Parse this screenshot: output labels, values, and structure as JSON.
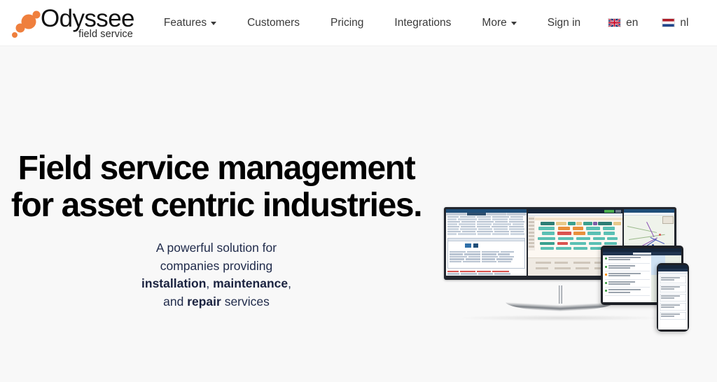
{
  "header": {
    "logo": {
      "name": "Odyssee",
      "tagline": "field service",
      "mark_icon": "odyssee-dots-logo",
      "accent_color": "#ef7f3d"
    },
    "nav_items": [
      {
        "label": "Features",
        "has_dropdown": true,
        "name": "nav-features"
      },
      {
        "label": "Customers",
        "has_dropdown": false,
        "name": "nav-customers"
      },
      {
        "label": "Pricing",
        "has_dropdown": false,
        "name": "nav-pricing"
      },
      {
        "label": "Integrations",
        "has_dropdown": false,
        "name": "nav-integrations"
      },
      {
        "label": "More",
        "has_dropdown": true,
        "name": "nav-more"
      }
    ],
    "sign_in_label": "Sign in",
    "languages": [
      {
        "code": "en",
        "flag": "uk-flag-icon"
      },
      {
        "code": "nl",
        "flag": "netherlands-flag-icon"
      }
    ]
  },
  "hero": {
    "title_line1": "Field service management",
    "title_line2": "for asset centric industries.",
    "sub_line1": "A powerful solution for",
    "sub_line2": "companies providing",
    "sub_strong1": "installation",
    "sub_comma1": ", ",
    "sub_strong2": "maintenance",
    "sub_comma2": ",",
    "sub_and": "and ",
    "sub_strong3": "repair",
    "sub_tail": " services",
    "title_color": "#000000",
    "sub_color": "#1f2a4a",
    "background_color": "#f8f8f8"
  },
  "mockup": {
    "alt": "Odyssee field service software shown on a widescreen monitor, tablet and smartphone",
    "devices": [
      "monitor",
      "tablet",
      "phone"
    ],
    "monitor_panes": [
      "job-list-grid",
      "planning-gantt",
      "route-map"
    ],
    "tablet_view": "work-order-list-with-map",
    "phone_view": "mobile-job-cards"
  }
}
